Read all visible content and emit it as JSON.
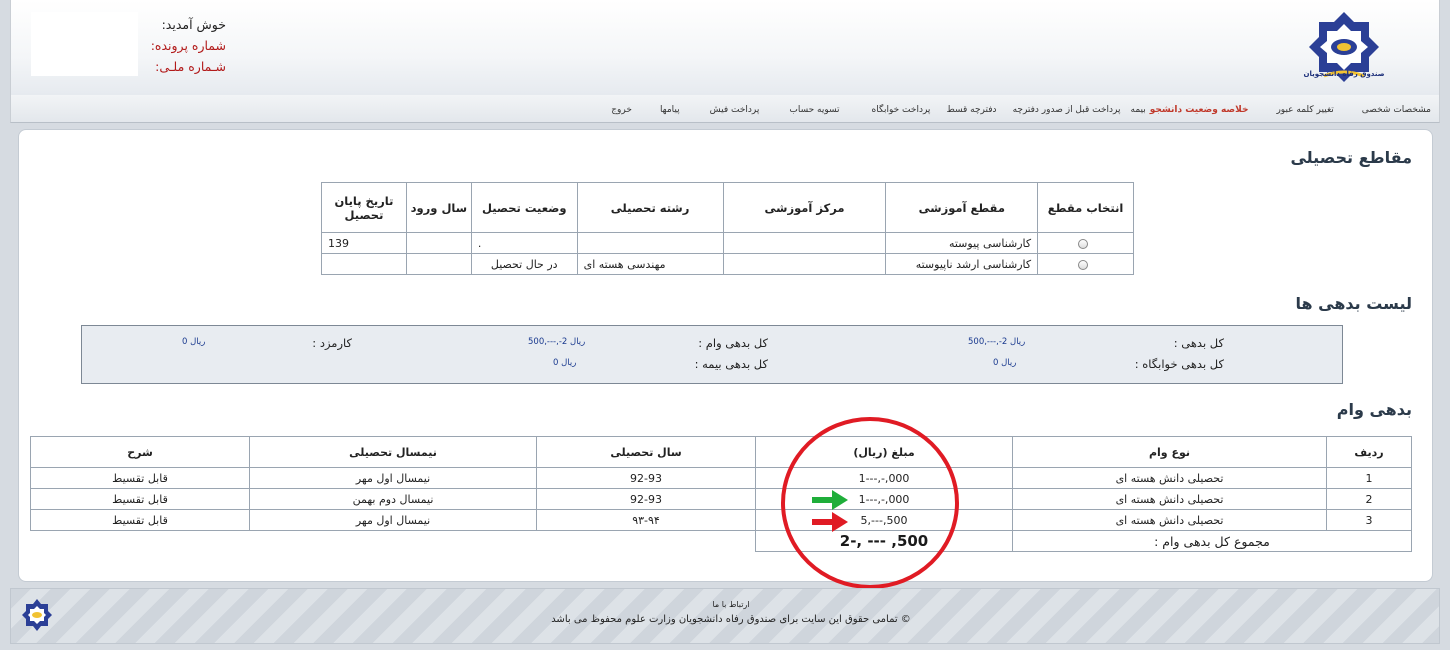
{
  "header": {
    "welcome": "خوش آمدید:",
    "file_number": "شماره پرونده:",
    "national_id": "شـماره ملـی:",
    "logo_caption": "صندوق رفاه دانشجویان"
  },
  "nav": {
    "items": [
      {
        "label": "مشخصات شخصی",
        "active": false
      },
      {
        "label": "تغییر کلمه عبور",
        "active": false
      },
      {
        "label": "خلاصه وضعیت دانشجو",
        "active": true
      },
      {
        "label": "بیمه",
        "active": false
      },
      {
        "label": "پرداخت قبل از صدور دفترچه",
        "active": false
      },
      {
        "label": "دفترچه قسط",
        "active": false
      },
      {
        "label": "پرداخت خوابگاه",
        "active": false
      },
      {
        "label": "تسویه حساب",
        "active": false
      },
      {
        "label": "پرداخت فیش",
        "active": false
      },
      {
        "label": "پیامها",
        "active": false
      },
      {
        "label": "خروج",
        "active": false
      }
    ]
  },
  "courses": {
    "title": "مقاطع تحصیلی",
    "headers": [
      "انتخاب مقطع",
      "مقطع آموزشی",
      "مرکز آموزشی",
      "رشته تحصیلی",
      "وضعیت تحصیل",
      "سال ورود",
      "تاریخ پایان تحصیل"
    ],
    "rows": [
      {
        "level": "کارشناسی پیوسته",
        "center": "",
        "field": "",
        "status": ".",
        "year": "",
        "end": "139"
      },
      {
        "level": "کارشناسی ارشد ناپیوسته",
        "center": "",
        "field": "مهندسی هسته ای",
        "status": "در حال تحصیل",
        "year": "",
        "end": ""
      }
    ]
  },
  "debts": {
    "title": "لیست بدهی ها",
    "total_label": "کل بدهی :",
    "total_value": "500,---,-2 ریال",
    "loan_label": "کل بدهی وام :",
    "loan_value": "500,---,-2 ریال",
    "fee_label": "کارمزد :",
    "fee_value": "0 ریال",
    "dorm_label": "کل بدهی خوابگاه :",
    "dorm_value": "0 ریال",
    "insurance_label": "کل بدهی بیمه :",
    "insurance_value": "0 ریال"
  },
  "loans": {
    "title": "بدهی وام",
    "headers": [
      "ردیف",
      "نوع وام",
      "مبلغ (ریال)",
      "سال تحصیلی",
      "نیمسال تحصیلی",
      "شرح"
    ],
    "rows": [
      {
        "n": "1",
        "type": "تحصیلی دانش هسته ای",
        "amount": "000,-,---1",
        "year": "92-93",
        "term": "نیمسال اول مهر",
        "desc": "قابل تقسیط"
      },
      {
        "n": "2",
        "type": "تحصیلی دانش هسته ای",
        "amount": "000,-,---1",
        "year": "92-93",
        "term": "نیمسال دوم بهمن",
        "desc": "قابل تقسیط"
      },
      {
        "n": "3",
        "type": "تحصیلی دانش هسته ای",
        "amount": "500,---,5",
        "year": "۹۳-۹۴",
        "term": "نیمسال اول مهر",
        "desc": "قابل تقسیط"
      }
    ],
    "total_label": "مجموع کل بدهی وام :",
    "total_value": "500, --- ,-2"
  },
  "footer": {
    "contact": "ارتباط با ما",
    "copyright": "© تمامی حقوق این سایت برای صندوق رفاه دانشجویان وزارت علوم محفوظ می باشد"
  },
  "colors": {
    "active_nav": "#c0392b",
    "annotation_circle": "#e01b24",
    "green_arrow": "#1fae3a",
    "red_arrow": "#e01b24"
  }
}
